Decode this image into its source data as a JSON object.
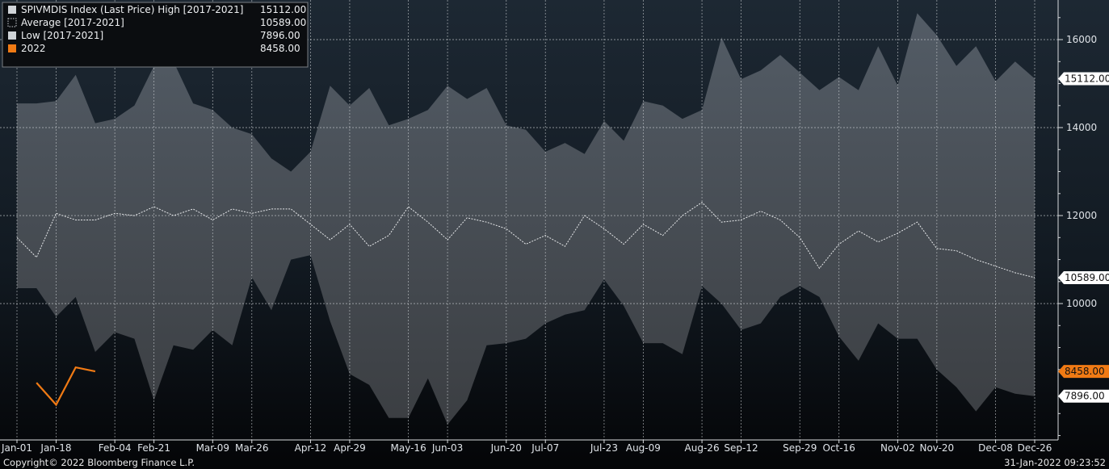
{
  "chart_data": {
    "type": "area",
    "title": "",
    "legend": [
      {
        "label": "SPIVMDIS Index (Last Price) High [2017-2021]",
        "value": "15112.00",
        "color": "#cfd3d7",
        "marker": "solid"
      },
      {
        "label": "Average  [2017-2021]",
        "value": "10589.00",
        "color": "#cfd3d7",
        "marker": "dotted"
      },
      {
        "label": "Low  [2017-2021]",
        "value": "7896.00",
        "color": "#cfd3d7",
        "marker": "solid"
      },
      {
        "label": "2022",
        "value": "8458.00",
        "color": "#f07a14",
        "marker": "solid"
      }
    ],
    "legend_position": "top-left",
    "x_ticks": [
      "Jan-01",
      "Jan-18",
      "Feb-04",
      "Feb-21",
      "Mar-09",
      "Mar-26",
      "Apr-12",
      "Apr-29",
      "May-16",
      "Jun-03",
      "Jun-20",
      "Jul-07",
      "Jul-23",
      "Aug-09",
      "Aug-26",
      "Sep-12",
      "Sep-29",
      "Oct-16",
      "Nov-02",
      "Nov-20",
      "Dec-08",
      "Dec-26"
    ],
    "y_ticks": [
      10000,
      12000,
      14000,
      16000
    ],
    "ylim": [
      6900,
      16900
    ],
    "grid": true,
    "last_value_tags": [
      {
        "value": "15112.00",
        "y": 15112,
        "bg": "#ffffff"
      },
      {
        "value": "10589.00",
        "y": 10589,
        "bg": "#ffffff"
      },
      {
        "value": "8458.00",
        "y": 8458,
        "bg": "#f07a14"
      },
      {
        "value": "7896.00",
        "y": 7896,
        "bg": "#ffffff"
      }
    ],
    "series": [
      {
        "name": "High [2017-2021]",
        "values": [
          14550,
          14550,
          14600,
          15200,
          14100,
          14200,
          14500,
          15400,
          15500,
          14550,
          14400,
          14000,
          13850,
          13300,
          13000,
          13450,
          14950,
          14500,
          14900,
          14050,
          14200,
          14400,
          14950,
          14650,
          14900,
          14050,
          13950,
          13450,
          13650,
          13400,
          14150,
          13700,
          14600,
          14500,
          14200,
          14400,
          16050,
          15100,
          15300,
          15650,
          15250,
          14850,
          15150,
          14850,
          15850,
          14950,
          16600,
          16100,
          15400,
          15850,
          15050,
          15500,
          15112
        ]
      },
      {
        "name": "Average [2017-2021]",
        "values": [
          11500,
          11050,
          12050,
          11900,
          11900,
          12050,
          12000,
          12200,
          12000,
          12150,
          11900,
          12150,
          12050,
          12150,
          12150,
          11800,
          11450,
          11800,
          11300,
          11550,
          12200,
          11850,
          11450,
          11950,
          11850,
          11700,
          11350,
          11550,
          11300,
          12000,
          11700,
          11350,
          11800,
          11550,
          12000,
          12300,
          11850,
          11900,
          12100,
          11900,
          11500,
          10800,
          11350,
          11650,
          11400,
          11600,
          11850,
          11250,
          11200,
          11000,
          10850,
          10700,
          10589
        ]
      },
      {
        "name": "Low [2017-2021]",
        "values": [
          10350,
          10350,
          9700,
          10150,
          8900,
          9350,
          9200,
          7800,
          9050,
          8950,
          9400,
          9050,
          10600,
          9850,
          11000,
          11100,
          9600,
          8400,
          8150,
          7400,
          7400,
          8300,
          7250,
          7800,
          9050,
          9100,
          9200,
          9550,
          9750,
          9850,
          10550,
          9950,
          9100,
          9100,
          8850,
          10400,
          10000,
          9400,
          9550,
          10150,
          10400,
          10150,
          9250,
          8700,
          9550,
          9200,
          9200,
          8500,
          8100,
          7550,
          8100,
          7950,
          7896
        ]
      },
      {
        "name": "2022",
        "values": [
          8200,
          7700,
          8550,
          8458
        ]
      }
    ]
  },
  "footer": {
    "copyright": "Copyright© 2022 Bloomberg Finance L.P.",
    "timestamp": "31-Jan-2022 09:23:52"
  }
}
